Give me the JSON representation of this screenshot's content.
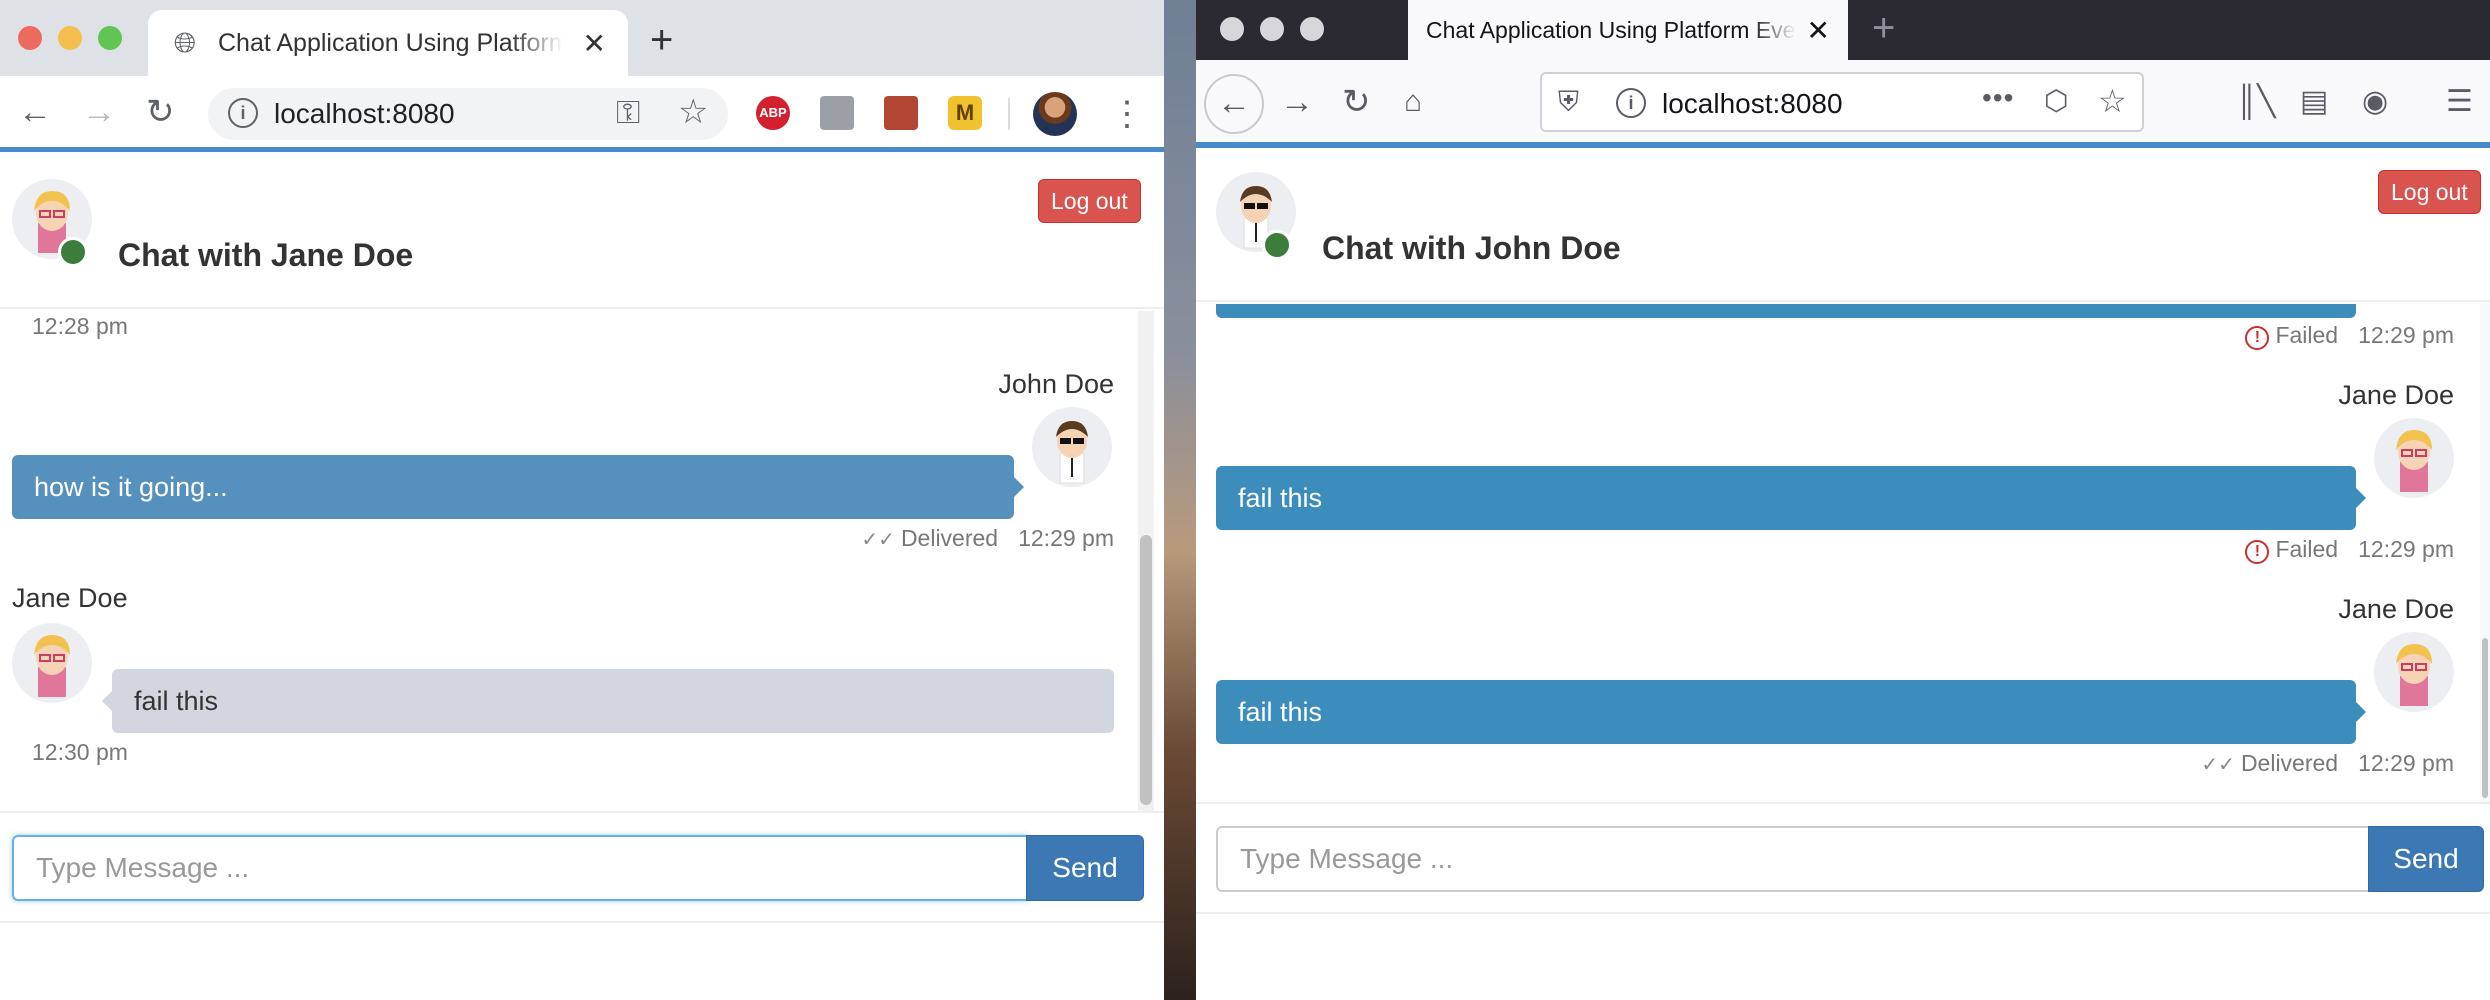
{
  "left_window": {
    "tab_title": "Chat Application Using Platform Events",
    "url": "localhost:8080",
    "extensions": [
      "ABP",
      "M"
    ],
    "chat": {
      "title": "Chat with Jane Doe",
      "logout_label": "Log out",
      "messages": {
        "top_time": "12:28 pm",
        "john_sender": "John Doe",
        "john_text": "how is it going...",
        "john_status": "Delivered",
        "john_time": "12:29 pm",
        "jane_sender": "Jane Doe",
        "jane_text": "fail this",
        "jane_time": "12:30 pm"
      },
      "input_placeholder": "Type Message ...",
      "send_label": "Send"
    }
  },
  "right_window": {
    "tab_title": "Chat Application Using Platform Events",
    "url": "localhost:8080",
    "chat": {
      "title": "Chat with John Doe",
      "logout_label": "Log out",
      "messages": {
        "top_status": "Failed",
        "top_time": "12:29 pm",
        "m1_sender": "Jane Doe",
        "m1_text": "fail this",
        "m1_status": "Failed",
        "m1_time": "12:29 pm",
        "m2_sender": "Jane Doe",
        "m2_text": "fail this",
        "m2_status": "Delivered",
        "m2_time": "12:29 pm"
      },
      "input_placeholder": "Type Message ...",
      "send_label": "Send"
    }
  },
  "colors": {
    "outgoing_bubble": "#3c8dbc",
    "incoming_bubble": "#d2d6de",
    "logout_button": "#d9534f",
    "send_button": "#3c78b4",
    "online_status": "#3d7d3b",
    "accent_border": "#4a89c9"
  }
}
